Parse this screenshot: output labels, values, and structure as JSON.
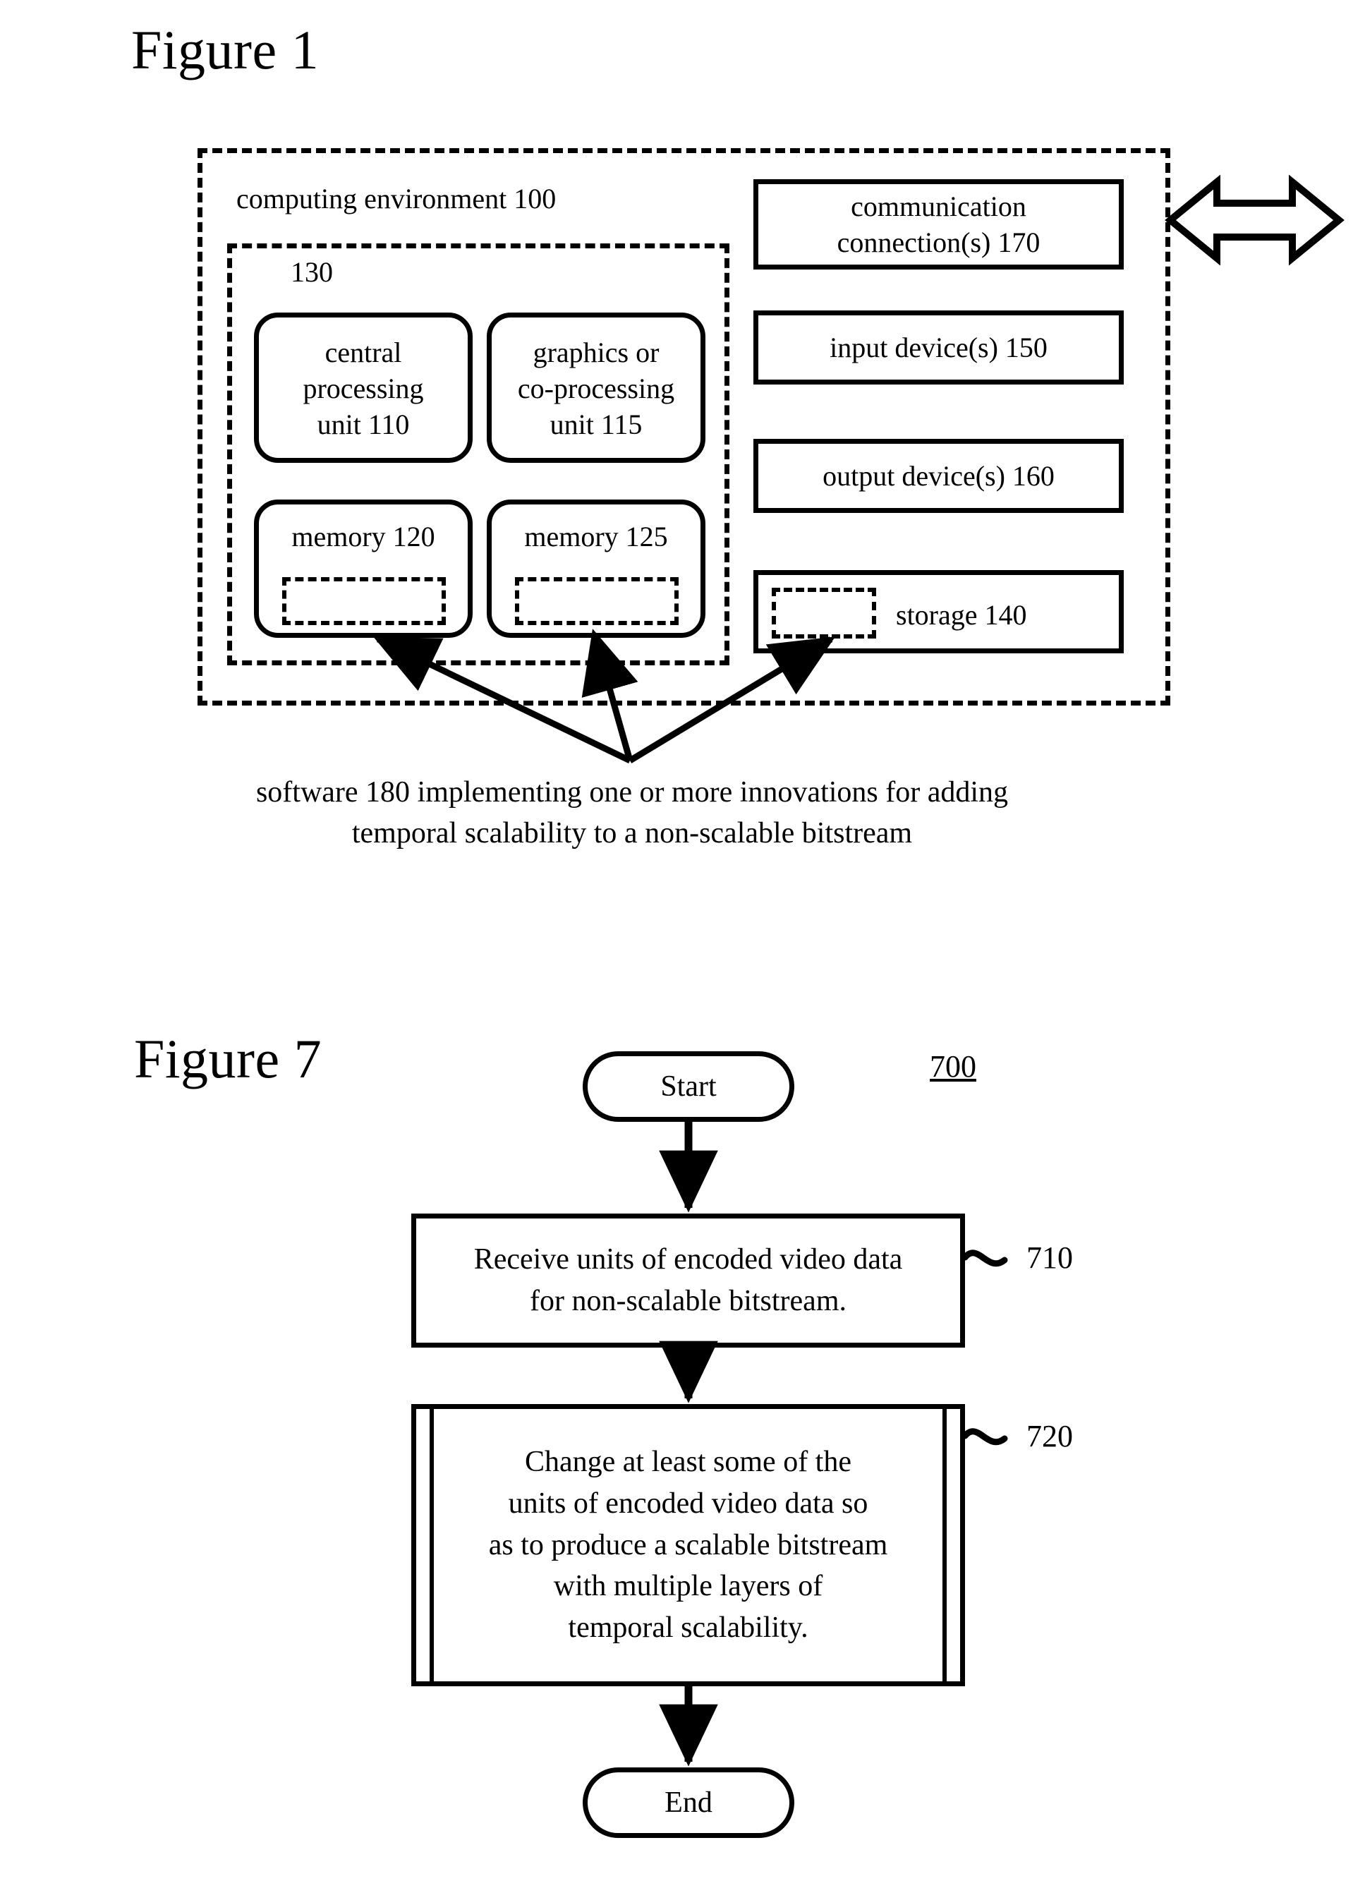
{
  "figure1": {
    "title": "Figure 1",
    "environment_label": "computing environment 100",
    "processing_group_label": "130",
    "units": [
      {
        "lines": [
          "central",
          "processing",
          "unit 110"
        ]
      },
      {
        "lines": [
          "graphics or",
          "co-processing",
          "unit 115"
        ]
      }
    ],
    "memories": [
      {
        "label": "memory 120"
      },
      {
        "label": "memory 125"
      }
    ],
    "right_boxes": [
      {
        "lines": [
          "communication",
          "connection(s) 170"
        ]
      },
      {
        "lines": [
          "input device(s) 150"
        ]
      },
      {
        "lines": [
          "output device(s) 160"
        ]
      }
    ],
    "storage_label": "storage 140",
    "caption": [
      "software 180 implementing one or more innovations for adding",
      "temporal scalability to a non-scalable bitstream"
    ]
  },
  "figure7": {
    "title": "Figure 7",
    "flow_ref": "700",
    "start_label": "Start",
    "end_label": "End",
    "steps": [
      {
        "ref": "710",
        "lines": [
          "Receive units of encoded video data",
          "for non-scalable bitstream."
        ]
      },
      {
        "ref": "720",
        "lines": [
          "Change at least some of the",
          "units of encoded video data so",
          "as to produce a scalable bitstream",
          "with multiple layers of",
          "temporal scalability."
        ]
      }
    ]
  },
  "style": {
    "ink": "#000000",
    "paper": "#ffffff"
  }
}
